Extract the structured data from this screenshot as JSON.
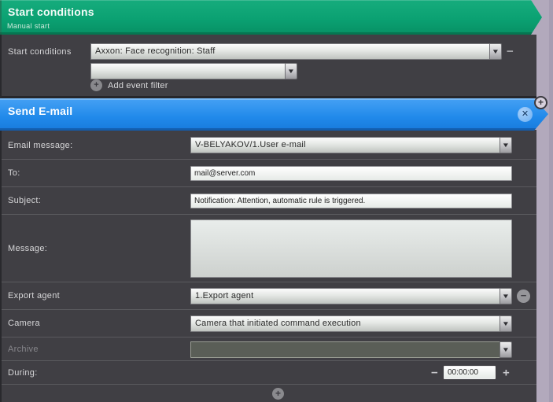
{
  "colors": {
    "header_green": "#0ba172",
    "header_blue": "#2089ea",
    "panel_dark": "#403f44",
    "desktop_lavender": "#b2a9bc"
  },
  "icons": {
    "dropdown_arrow": "▼",
    "plus": "+",
    "minus": "−",
    "close": "✕"
  },
  "start_conditions": {
    "title": "Start conditions",
    "subtitle": "Manual start",
    "row_label": "Start conditions",
    "filter1": "Axxon: Face recognition: Staff",
    "filter2": "",
    "add_event_filter_label": "Add event filter"
  },
  "send_email": {
    "title": "Send E-mail",
    "email_message": {
      "label": "Email message:",
      "value": "V-BELYAKOV/1.User e-mail"
    },
    "to": {
      "label": "To:",
      "value": "mail@server.com"
    },
    "subject": {
      "label": "Subject:",
      "value": "Notification: Attention, automatic rule is triggered."
    },
    "message": {
      "label": "Message:",
      "value": ""
    },
    "export_agent": {
      "label": "Export agent",
      "value": "1.Export agent"
    },
    "camera": {
      "label": "Camera",
      "value": "Camera that initiated command execution"
    },
    "archive": {
      "label": "Archive",
      "value": ""
    },
    "during": {
      "label": "During:",
      "value": "00:00:00"
    }
  }
}
